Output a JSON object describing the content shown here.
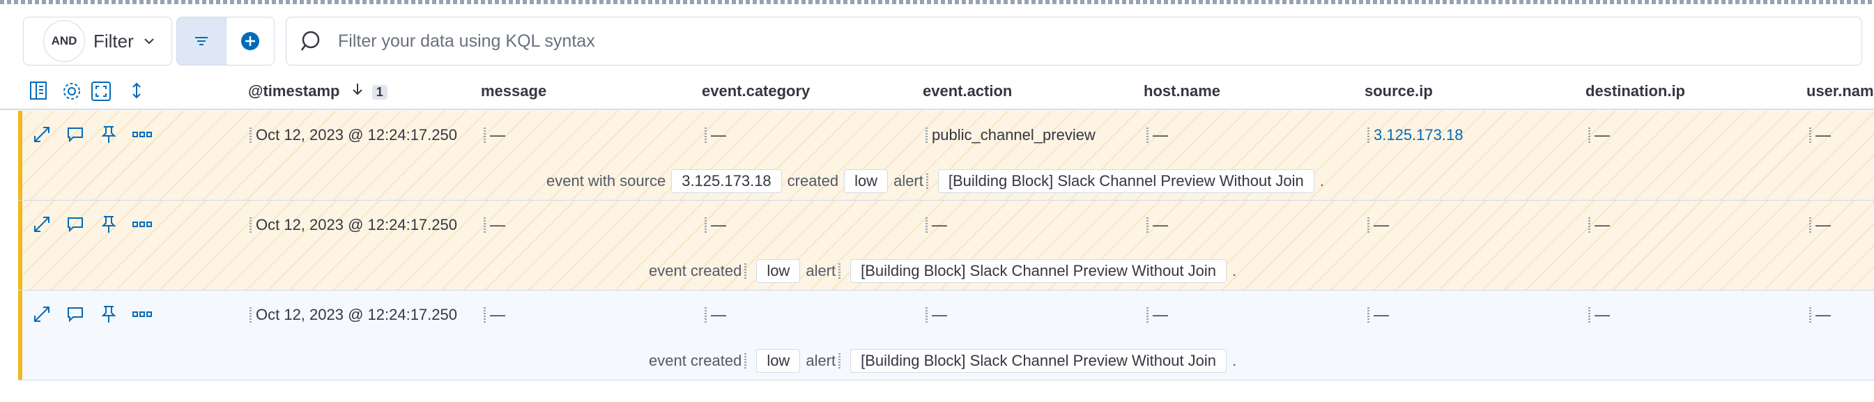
{
  "filter": {
    "and_label": "AND",
    "filter_label": "Filter"
  },
  "search": {
    "placeholder": "Filter your data using KQL syntax"
  },
  "header": {
    "columns": [
      "@timestamp",
      "message",
      "event.category",
      "event.action",
      "host.name",
      "source.ip",
      "destination.ip",
      "user.name"
    ],
    "sort_count": "1"
  },
  "rows": [
    {
      "timestamp": "Oct 12, 2023 @ 12:24:17.250",
      "message": "—",
      "event_category": "—",
      "event_action": "public_channel_preview",
      "host_name": "—",
      "source_ip": "3.125.173.18",
      "destination_ip": "—",
      "user_name": "—",
      "summary": {
        "prefix": "event with source",
        "source": "3.125.173.18",
        "created": "created",
        "severity": "low",
        "alert": "alert",
        "rule": "[Building Block] Slack Channel Preview Without Join",
        "end": "."
      }
    },
    {
      "timestamp": "Oct 12, 2023 @ 12:24:17.250",
      "message": "—",
      "event_category": "—",
      "event_action": "—",
      "host_name": "—",
      "source_ip": "—",
      "destination_ip": "—",
      "user_name": "—",
      "summary": {
        "prefix": "event created",
        "severity": "low",
        "alert": "alert",
        "rule": "[Building Block] Slack Channel Preview Without Join",
        "end": "."
      }
    },
    {
      "timestamp": "Oct 12, 2023 @ 12:24:17.250",
      "message": "—",
      "event_category": "—",
      "event_action": "—",
      "host_name": "—",
      "source_ip": "—",
      "destination_ip": "—",
      "user_name": "—",
      "summary": {
        "prefix": "event created",
        "severity": "low",
        "alert": "alert",
        "rule": "[Building Block] Slack Channel Preview Without Join",
        "end": "."
      }
    }
  ],
  "colors": {
    "accent": "#006bb8",
    "row_marker": "#f0b81e",
    "highlight_bg": "#fdf4e3"
  }
}
